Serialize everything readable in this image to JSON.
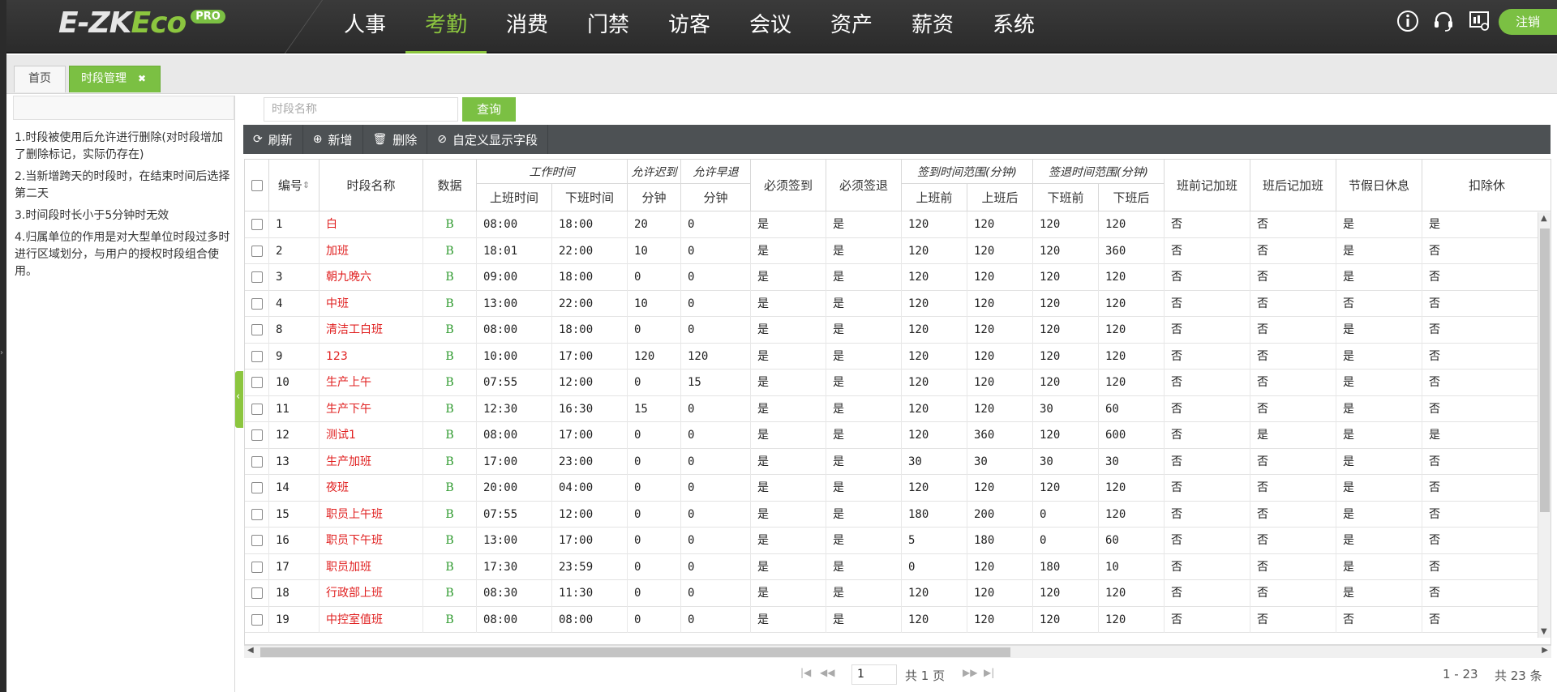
{
  "header": {
    "logo_text": "E-ZKEco",
    "logo_badge": "PRO",
    "nav": [
      "人事",
      "考勤",
      "消费",
      "门禁",
      "访客",
      "会议",
      "资产",
      "薪资",
      "系统"
    ],
    "active_nav": "考勤",
    "icons": [
      "info-icon",
      "headset-icon",
      "monitor-icon"
    ],
    "logout_label": "注销",
    "accent_color": "#7bc043"
  },
  "tabs": {
    "home_label": "首页",
    "active_label": "时段管理",
    "close_glyph": "✖"
  },
  "left_panel": {
    "notes": [
      "1.时段被使用后允许进行删除(对时段增加了删除标记，实际仍存在)",
      "2.当新增跨天的时段时，在结束时间后选择第二天",
      "3.时间段时长小于5分钟时无效",
      "4.归属单位的作用是对大型单位时段过多时进行区域划分，与用户的授权时段组合使用。"
    ]
  },
  "search": {
    "placeholder": "时段名称",
    "query_label": "查询"
  },
  "toolbar": {
    "refresh": "刷新",
    "add": "新增",
    "delete": "删除",
    "custom_fields": "自定义显示字段"
  },
  "table": {
    "headers": {
      "id": "编号",
      "name": "时段名称",
      "data": "数据",
      "work_time": "工作时间",
      "on_duty": "上班时间",
      "off_duty": "下班时间",
      "allow_late": "允许迟到",
      "allow_early": "允许早退",
      "minutes": "分钟",
      "must_checkin": "必须签到",
      "must_checkout": "必须签退",
      "checkin_range": "签到时间范围(分钟)",
      "checkout_range": "签退时间范围(分钟)",
      "before_on": "上班前",
      "after_on": "上班后",
      "before_off": "下班前",
      "after_off": "下班后",
      "ot_before": "班前记加班",
      "ot_after": "班后记加班",
      "holiday_rest": "节假日休息",
      "deduct": "扣除休"
    },
    "rows": [
      [
        "1",
        "白",
        "B",
        "08:00",
        "18:00",
        "20",
        "0",
        "是",
        "是",
        "120",
        "120",
        "120",
        "120",
        "否",
        "否",
        "是",
        "是"
      ],
      [
        "2",
        "加班",
        "B",
        "18:01",
        "22:00",
        "10",
        "0",
        "是",
        "是",
        "120",
        "120",
        "120",
        "360",
        "否",
        "否",
        "是",
        "否"
      ],
      [
        "3",
        "朝九晚六",
        "B",
        "09:00",
        "18:00",
        "0",
        "0",
        "是",
        "是",
        "120",
        "120",
        "120",
        "120",
        "否",
        "否",
        "是",
        "否"
      ],
      [
        "4",
        "中班",
        "B",
        "13:00",
        "22:00",
        "10",
        "0",
        "是",
        "是",
        "120",
        "120",
        "120",
        "120",
        "否",
        "否",
        "否",
        "否"
      ],
      [
        "8",
        "清洁工白班",
        "B",
        "08:00",
        "18:00",
        "0",
        "0",
        "是",
        "是",
        "120",
        "120",
        "120",
        "120",
        "否",
        "否",
        "是",
        "否"
      ],
      [
        "9",
        "123",
        "B",
        "10:00",
        "17:00",
        "120",
        "120",
        "是",
        "是",
        "120",
        "120",
        "120",
        "120",
        "否",
        "否",
        "是",
        "否"
      ],
      [
        "10",
        "生产上午",
        "B",
        "07:55",
        "12:00",
        "0",
        "15",
        "是",
        "是",
        "120",
        "120",
        "120",
        "120",
        "否",
        "否",
        "是",
        "否"
      ],
      [
        "11",
        "生产下午",
        "B",
        "12:30",
        "16:30",
        "15",
        "0",
        "是",
        "是",
        "120",
        "120",
        "30",
        "60",
        "否",
        "否",
        "是",
        "否"
      ],
      [
        "12",
        "测试1",
        "B",
        "08:00",
        "17:00",
        "0",
        "0",
        "是",
        "是",
        "120",
        "360",
        "120",
        "600",
        "否",
        "是",
        "是",
        "是"
      ],
      [
        "13",
        "生产加班",
        "B",
        "17:00",
        "23:00",
        "0",
        "0",
        "是",
        "是",
        "30",
        "30",
        "30",
        "30",
        "否",
        "否",
        "是",
        "否"
      ],
      [
        "14",
        "夜班",
        "B",
        "20:00",
        "04:00",
        "0",
        "0",
        "是",
        "是",
        "120",
        "120",
        "120",
        "120",
        "否",
        "否",
        "是",
        "否"
      ],
      [
        "15",
        "职员上午班",
        "B",
        "07:55",
        "12:00",
        "0",
        "0",
        "是",
        "是",
        "180",
        "200",
        "0",
        "120",
        "否",
        "否",
        "是",
        "否"
      ],
      [
        "16",
        "职员下午班",
        "B",
        "13:00",
        "17:00",
        "0",
        "0",
        "是",
        "是",
        "5",
        "180",
        "0",
        "60",
        "否",
        "否",
        "是",
        "否"
      ],
      [
        "17",
        "职员加班",
        "B",
        "17:30",
        "23:59",
        "0",
        "0",
        "是",
        "是",
        "0",
        "120",
        "180",
        "10",
        "否",
        "否",
        "是",
        "否"
      ],
      [
        "18",
        "行政部上班",
        "B",
        "08:30",
        "11:30",
        "0",
        "0",
        "是",
        "是",
        "120",
        "120",
        "120",
        "120",
        "否",
        "否",
        "是",
        "否"
      ],
      [
        "19",
        "中控室值班",
        "B",
        "08:00",
        "08:00",
        "0",
        "0",
        "是",
        "是",
        "120",
        "120",
        "120",
        "120",
        "否",
        "否",
        "否",
        "否"
      ]
    ]
  },
  "pager": {
    "page_value": "1",
    "total_pages_text": "共 1 页",
    "range_text": "1 - 23",
    "total_text": "共 23 条"
  }
}
